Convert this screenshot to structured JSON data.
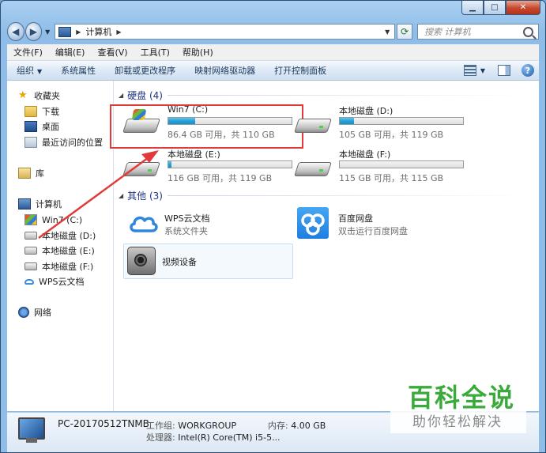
{
  "window": {
    "caption_min": "▁",
    "caption_max": "□",
    "caption_close": "✕"
  },
  "address": {
    "crumb": "计算机",
    "search_placeholder": "搜索 计算机"
  },
  "menu": [
    "文件(F)",
    "编辑(E)",
    "查看(V)",
    "工具(T)",
    "帮助(H)"
  ],
  "toolbar": {
    "organize": "组织",
    "items": [
      "系统属性",
      "卸载或更改程序",
      "映射网络驱动器",
      "打开控制面板"
    ]
  },
  "nav": {
    "favorites": "收藏夹",
    "fav_items": [
      "下载",
      "桌面",
      "最近访问的位置"
    ],
    "library": "库",
    "computer": "计算机",
    "computer_items": [
      "Win7 (C:)",
      "本地磁盘 (D:)",
      "本地磁盘 (E:)",
      "本地磁盘 (F:)",
      "WPS云文档"
    ],
    "network": "网络"
  },
  "groups": {
    "hdd": "硬盘 (4)",
    "other": "其他 (3)"
  },
  "drives": [
    {
      "name": "Win7 (C:)",
      "free": "86.4 GB 可用，共 110 GB",
      "used_fraction": 0.215
    },
    {
      "name": "本地磁盘 (D:)",
      "free": "105 GB 可用，共 119 GB",
      "used_fraction": 0.118
    },
    {
      "name": "本地磁盘 (E:)",
      "free": "116 GB 可用，共 119 GB",
      "used_fraction": 0.025
    },
    {
      "name": "本地磁盘 (F:)",
      "free": "115 GB 可用，共 115 GB",
      "used_fraction": 0.0
    }
  ],
  "others": [
    {
      "name": "WPS云文档",
      "desc": "系统文件夹"
    },
    {
      "name": "百度网盘",
      "desc": "双击运行百度网盘"
    },
    {
      "name": "视频设备",
      "desc": ""
    }
  ],
  "status": {
    "pc_name": "PC-20170512TNMB",
    "workgroup_label": "工作组:",
    "workgroup": "WORKGROUP",
    "memory_label": "内存:",
    "memory": "4.00 GB",
    "cpu_label": "处理器:",
    "cpu": "Intel(R) Core(TM) i5-5..."
  },
  "watermark": {
    "title": "百科全说",
    "subtitle": "助你轻松解决"
  },
  "colors": {
    "highlight": "#e03a3a",
    "watermark_green": "#3aaa3a",
    "group_head": "#1e3287"
  }
}
